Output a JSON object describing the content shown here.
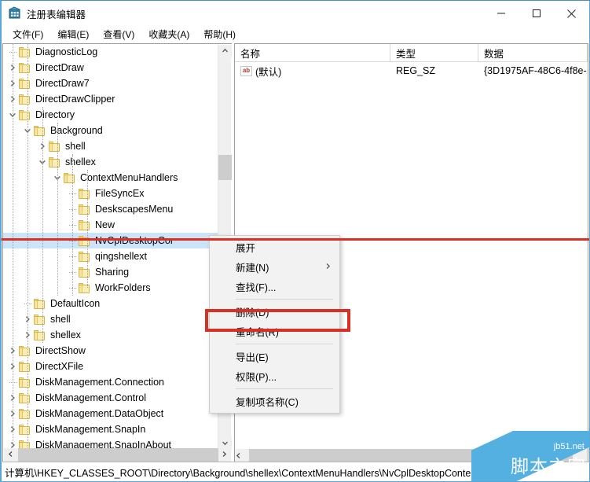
{
  "window": {
    "title": "注册表编辑器",
    "icon": "registry-editor-icon",
    "controls": {
      "minimize": "minimize-icon",
      "maximize": "maximize-icon",
      "close": "close-icon"
    }
  },
  "menubar": {
    "items": [
      {
        "label": "文件(F)"
      },
      {
        "label": "编辑(E)"
      },
      {
        "label": "查看(V)"
      },
      {
        "label": "收藏夹(A)"
      },
      {
        "label": "帮助(H)"
      }
    ]
  },
  "tree": {
    "rows": [
      {
        "label": "DiagnosticLog",
        "indent": 1,
        "twisty": "none",
        "selected": false
      },
      {
        "label": "DirectDraw",
        "indent": 1,
        "twisty": "collapsed",
        "selected": false
      },
      {
        "label": "DirectDraw7",
        "indent": 1,
        "twisty": "collapsed",
        "selected": false
      },
      {
        "label": "DirectDrawClipper",
        "indent": 1,
        "twisty": "collapsed",
        "selected": false
      },
      {
        "label": "Directory",
        "indent": 1,
        "twisty": "expanded",
        "selected": false
      },
      {
        "label": "Background",
        "indent": 2,
        "twisty": "expanded",
        "selected": false
      },
      {
        "label": "shell",
        "indent": 3,
        "twisty": "collapsed",
        "selected": false
      },
      {
        "label": "shellex",
        "indent": 3,
        "twisty": "expanded",
        "selected": false
      },
      {
        "label": "ContextMenuHandlers",
        "indent": 4,
        "twisty": "expanded",
        "selected": false
      },
      {
        "label": "FileSyncEx",
        "indent": 5,
        "twisty": "none",
        "selected": false
      },
      {
        "label": "DeskscapesMenu",
        "indent": 5,
        "twisty": "none",
        "selected": false
      },
      {
        "label": "New",
        "indent": 5,
        "twisty": "none",
        "selected": false
      },
      {
        "label": "NvCplDesktopCor",
        "indent": 5,
        "twisty": "none",
        "selected": true
      },
      {
        "label": "qingshellext",
        "indent": 5,
        "twisty": "none",
        "selected": false
      },
      {
        "label": "Sharing",
        "indent": 5,
        "twisty": "none",
        "selected": false
      },
      {
        "label": "WorkFolders",
        "indent": 5,
        "twisty": "none",
        "selected": false
      },
      {
        "label": "DefaultIcon",
        "indent": 2,
        "twisty": "none",
        "selected": false
      },
      {
        "label": "shell",
        "indent": 2,
        "twisty": "collapsed",
        "selected": false
      },
      {
        "label": "shellex",
        "indent": 2,
        "twisty": "collapsed",
        "selected": false
      },
      {
        "label": "DirectShow",
        "indent": 1,
        "twisty": "collapsed",
        "selected": false
      },
      {
        "label": "DirectXFile",
        "indent": 1,
        "twisty": "collapsed",
        "selected": false
      },
      {
        "label": "DiskManagement.Connection",
        "indent": 1,
        "twisty": "none",
        "selected": false
      },
      {
        "label": "DiskManagement.Control",
        "indent": 1,
        "twisty": "collapsed",
        "selected": false
      },
      {
        "label": "DiskManagement.DataObject",
        "indent": 1,
        "twisty": "collapsed",
        "selected": false
      },
      {
        "label": "DiskManagement.SnapIn",
        "indent": 1,
        "twisty": "collapsed",
        "selected": false
      },
      {
        "label": "DiskManagement.SnapInAbout",
        "indent": 1,
        "twisty": "collapsed",
        "selected": false
      }
    ],
    "scrollbar": {
      "up_arrow": "chevron-up-icon",
      "down_arrow": "chevron-down-icon",
      "left_arrow": "chevron-left-icon",
      "right_arrow": "chevron-right-icon"
    }
  },
  "list": {
    "columns": [
      {
        "label": "名称",
        "width": 198
      },
      {
        "label": "类型",
        "width": 112
      },
      {
        "label": "数据",
        "width": 139
      }
    ],
    "rows": [
      {
        "icon": "string-value-icon",
        "icon_text": "ab",
        "name": "(默认)",
        "type": "REG_SZ",
        "data": "{3D1975AF-48C6-4f8e-"
      }
    ],
    "hscroll_left_arrow": "chevron-left-icon"
  },
  "context_menu": {
    "items": [
      {
        "label": "展开",
        "submenu": false,
        "separator_after": false
      },
      {
        "label": "新建(N)",
        "submenu": true,
        "separator_after": false
      },
      {
        "label": "查找(F)...",
        "submenu": false,
        "separator_after": true
      },
      {
        "label": "删除(D)",
        "submenu": false,
        "separator_after": false
      },
      {
        "label": "重命名(R)",
        "submenu": false,
        "separator_after": true
      },
      {
        "label": "导出(E)",
        "submenu": false,
        "separator_after": false
      },
      {
        "label": "权限(P)...",
        "submenu": false,
        "separator_after": true
      },
      {
        "label": "复制项名称(C)",
        "submenu": false,
        "separator_after": false
      }
    ],
    "submenu_arrow": "chevron-right-icon"
  },
  "statusbar": {
    "path": "计算机\\HKEY_CLASSES_ROOT\\Directory\\Background\\shellex\\ContextMenuHandlers\\NvCplDesktopConte"
  },
  "watermark": {
    "url": "jb51.net",
    "name": "脚本之家"
  },
  "annotations": {
    "line_color": "#d93025",
    "box_color": "#d93025",
    "highlighted_menu_item": "删除(D)"
  },
  "colors": {
    "selection": "#cce4f7",
    "window_border": "#5aa6d8",
    "folder": "#fbeeb5",
    "watermark": "#53b0e0"
  }
}
